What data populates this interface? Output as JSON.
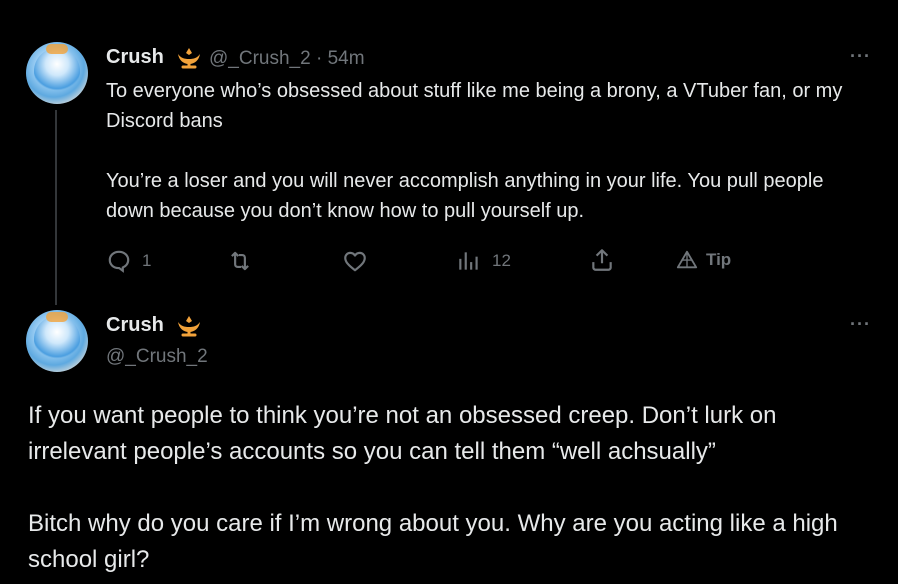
{
  "tweets": [
    {
      "display_name": "Crush",
      "handle": "@_Crush_2",
      "separator": "·",
      "time": "54m",
      "body": "To everyone who’s obsessed about stuff like me being a brony, a VTuber fan, or my Discord bans\n\nYou’re a loser and you will never accomplish anything in your life. You pull people down because you don’t know how to pull yourself up.",
      "actions": {
        "replies": "1",
        "retweets": "",
        "likes": "",
        "views": "12",
        "tip_label": "Tip"
      },
      "more_label": "···"
    },
    {
      "display_name": "Crush",
      "handle": "@_Crush_2",
      "body": "If you want people to think you’re not an obsessed creep. Don’t lurk on irrelevant people’s accounts so you can tell them “well achsually”\n\nBitch why do you care if I’m wrong about you. Why are you acting like a high school girl?",
      "more_label": "···"
    }
  ],
  "icons": {
    "verified_badge": "gold-crown-badge-icon",
    "reply": "reply-icon",
    "retweet": "retweet-icon",
    "like": "heart-icon",
    "views": "views-bar-icon",
    "share": "share-icon",
    "tip": "tip-icon"
  },
  "colors": {
    "background": "#000000",
    "text_primary": "#e7e9ea",
    "text_secondary": "#71767b",
    "badge_gold": "#f2a23a",
    "thread_line": "#333639"
  }
}
